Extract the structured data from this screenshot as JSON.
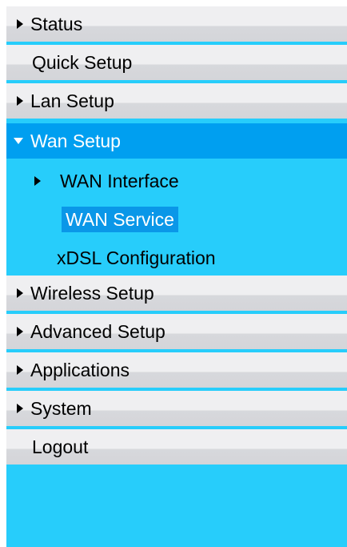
{
  "menu": {
    "items": [
      {
        "label": "Status"
      },
      {
        "label": "Quick Setup"
      },
      {
        "label": "Lan Setup"
      },
      {
        "label": "Wan Setup"
      },
      {
        "label": "Wireless Setup"
      },
      {
        "label": "Advanced Setup"
      },
      {
        "label": "Applications"
      },
      {
        "label": "System"
      },
      {
        "label": "Logout"
      }
    ],
    "wan_submenu": [
      {
        "label": "WAN Interface"
      },
      {
        "label": "WAN Service"
      },
      {
        "label": "xDSL Configuration"
      }
    ]
  },
  "colors": {
    "menu_background": "#27cdfb",
    "item_background": "#efeff1",
    "open_item_background": "#009ff0",
    "active_subitem_background": "#0a97e8"
  },
  "icons": {
    "collapsed": "triangle-right-icon",
    "expanded": "triangle-down-icon"
  }
}
